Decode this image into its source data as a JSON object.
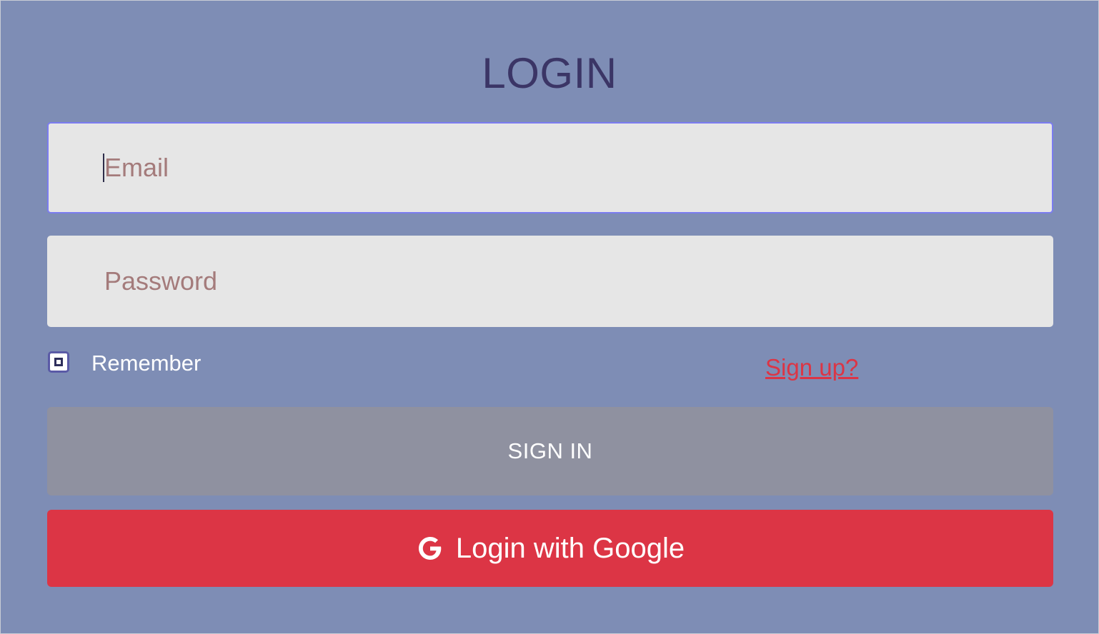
{
  "form": {
    "title": "LOGIN",
    "email_placeholder": "Email",
    "email_value": "",
    "password_placeholder": "Password",
    "password_value": "",
    "remember_label": "Remember",
    "remember_checked": false,
    "signup_link": "Sign up?",
    "signin_button": "SIGN IN",
    "google_button": "Login with Google"
  },
  "icons": {
    "google": "google-g-icon"
  },
  "colors": {
    "background": "#7e8db5",
    "title": "#3b3566",
    "input_bg": "#e6e6e6",
    "placeholder": "#a47b7b",
    "focus_border": "#7b7cf0",
    "signin_bg": "#8f91a0",
    "google_bg": "#dc3545",
    "signup_link": "#dc3545"
  }
}
